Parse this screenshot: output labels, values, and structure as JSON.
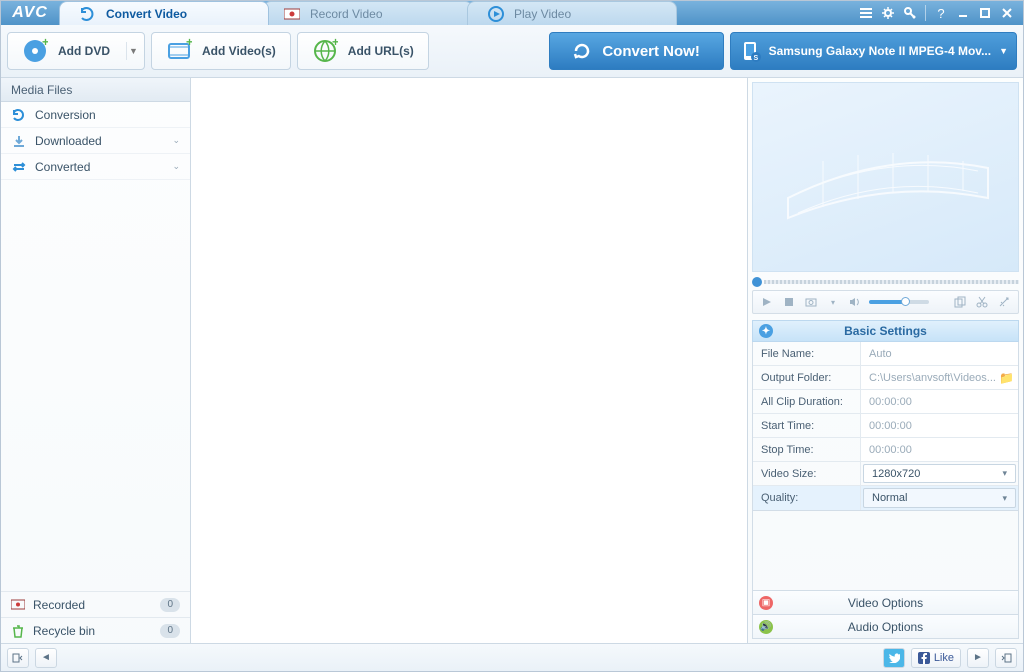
{
  "app": {
    "logo": "AVC"
  },
  "tabs": [
    {
      "label": "Convert Video",
      "active": true
    },
    {
      "label": "Record Video",
      "active": false
    },
    {
      "label": "Play Video",
      "active": false
    }
  ],
  "toolbar": {
    "add_dvd": "Add DVD",
    "add_videos": "Add Video(s)",
    "add_urls": "Add URL(s)",
    "convert": "Convert Now!",
    "profile": "Samsung Galaxy Note II MPEG-4 Mov..."
  },
  "sidebar": {
    "header": "Media Files",
    "items": [
      {
        "label": "Conversion",
        "expand": false
      },
      {
        "label": "Downloaded",
        "expand": true
      },
      {
        "label": "Converted",
        "expand": true
      }
    ],
    "footer": [
      {
        "label": "Recorded",
        "count": "0"
      },
      {
        "label": "Recycle bin",
        "count": "0"
      }
    ]
  },
  "settings": {
    "title": "Basic Settings",
    "rows": {
      "file_name": {
        "label": "File Name:",
        "value": "Auto"
      },
      "output_folder": {
        "label": "Output Folder:",
        "value": "C:\\Users\\anvsoft\\Videos..."
      },
      "all_clip": {
        "label": "All Clip Duration:",
        "value": "00:00:00"
      },
      "start_time": {
        "label": "Start Time:",
        "value": "00:00:00"
      },
      "stop_time": {
        "label": "Stop Time:",
        "value": "00:00:00"
      },
      "video_size": {
        "label": "Video Size:",
        "value": "1280x720"
      },
      "quality": {
        "label": "Quality:",
        "value": "Normal"
      }
    },
    "video_options": "Video Options",
    "audio_options": "Audio Options"
  },
  "statusbar": {
    "like": "Like"
  }
}
